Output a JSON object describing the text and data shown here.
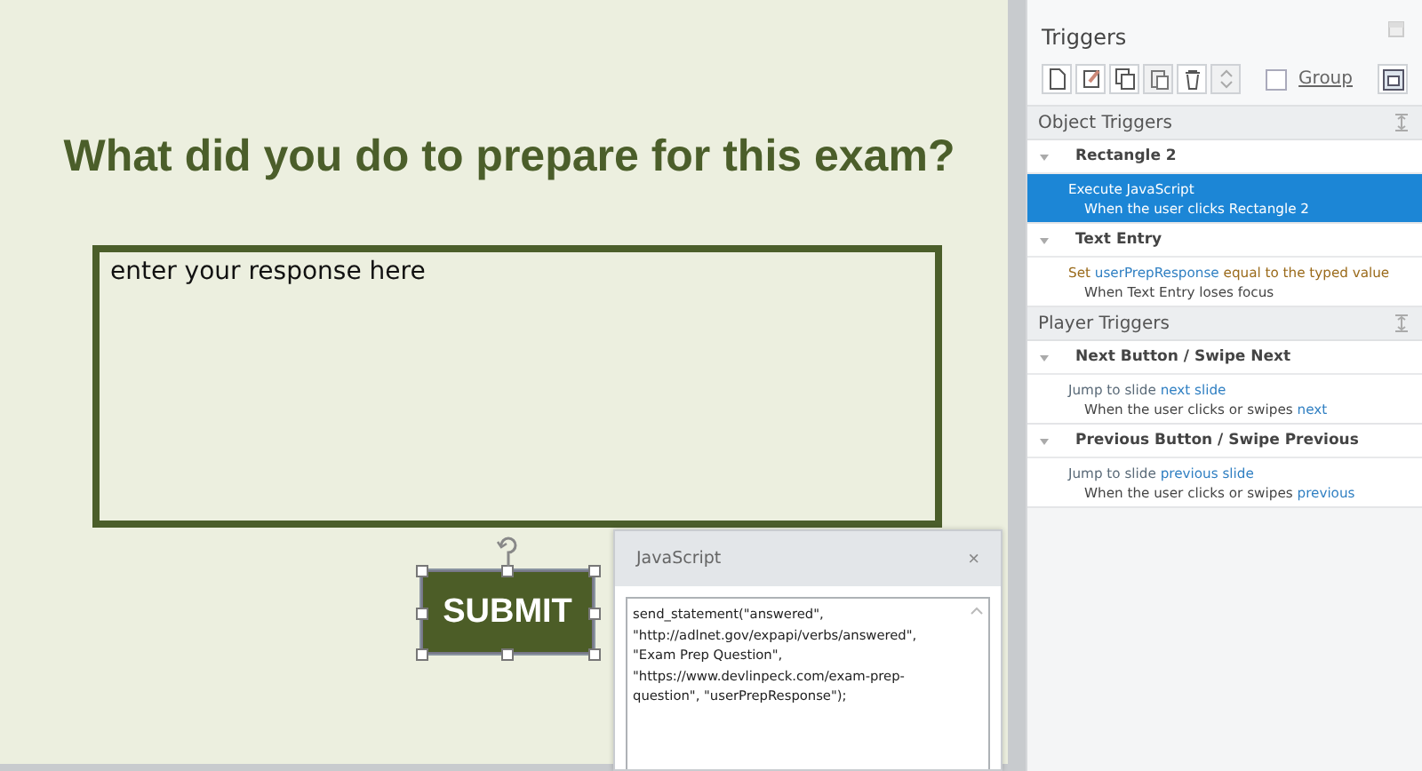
{
  "slide": {
    "question": "What did you do to prepare for this exam?",
    "entry": {
      "value": "enter your response here"
    },
    "submit": {
      "label": "SUBMIT",
      "selected": true
    }
  },
  "triggers": {
    "title": "Triggers",
    "group": {
      "label": "Group",
      "checked": false
    },
    "sections": [
      {
        "title": "Object Triggers",
        "groups": [
          {
            "name": "Rectangle 2",
            "expanded": true,
            "triggers": [
              {
                "selected": true,
                "action": [
                  {
                    "text": "Execute JavaScript",
                    "kind": "plain"
                  }
                ],
                "condition": [
                  {
                    "text": "When the user clicks Rectangle 2",
                    "kind": "plain"
                  }
                ]
              }
            ]
          },
          {
            "name": "Text Entry",
            "expanded": true,
            "triggers": [
              {
                "selected": false,
                "action": [
                  {
                    "text": "Set",
                    "kind": "accent"
                  },
                  {
                    "text": "userPrepResponse",
                    "kind": "link"
                  },
                  {
                    "text": "equal to the typed value",
                    "kind": "accent"
                  }
                ],
                "condition": [
                  {
                    "text": "When Text Entry loses focus",
                    "kind": "plain"
                  }
                ]
              }
            ]
          }
        ]
      },
      {
        "title": "Player Triggers",
        "groups": [
          {
            "name": "Next Button / Swipe Next",
            "expanded": true,
            "triggers": [
              {
                "selected": false,
                "action": [
                  {
                    "text": "Jump to slide",
                    "kind": "plain"
                  },
                  {
                    "text": "next slide",
                    "kind": "link"
                  }
                ],
                "condition": [
                  {
                    "text": "When the user clicks or swipes",
                    "kind": "plain"
                  },
                  {
                    "text": "next",
                    "kind": "link"
                  }
                ]
              }
            ]
          },
          {
            "name": "Previous Button / Swipe Previous",
            "expanded": true,
            "triggers": [
              {
                "selected": false,
                "action": [
                  {
                    "text": "Jump to slide",
                    "kind": "plain"
                  },
                  {
                    "text": "previous slide",
                    "kind": "link"
                  }
                ],
                "condition": [
                  {
                    "text": "When the user clicks or swipes",
                    "kind": "plain"
                  },
                  {
                    "text": "previous",
                    "kind": "link"
                  }
                ]
              }
            ]
          }
        ]
      }
    ]
  },
  "dialog": {
    "title": "JavaScript",
    "close": "×",
    "code": "send_statement(\"answered\", \"http://adlnet.gov/expapi/verbs/answered\", \"Exam Prep Question\", \"https://www.devlinpeck.com/exam-prep-question\", \"userPrepResponse\");"
  }
}
